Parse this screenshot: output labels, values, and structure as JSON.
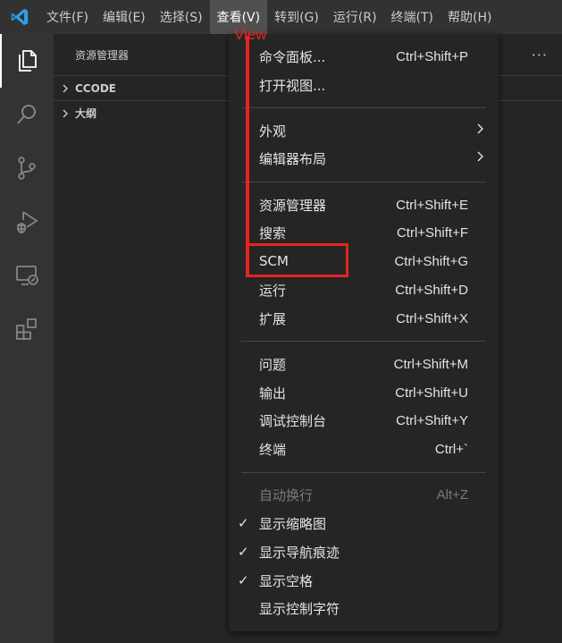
{
  "menubar": {
    "items": [
      "文件(F)",
      "编辑(E)",
      "选择(S)",
      "查看(V)",
      "转到(G)",
      "运行(R)",
      "终端(T)",
      "帮助(H)"
    ],
    "active_index": 3
  },
  "activitybar": {
    "icons": [
      "explorer-icon",
      "search-icon",
      "source-control-icon",
      "run-debug-icon",
      "remote-explorer-icon",
      "extensions-icon"
    ]
  },
  "sidebar": {
    "title": "资源管理器",
    "more": "···",
    "sections": [
      "CCODE",
      "大纲"
    ]
  },
  "annotation": {
    "label": "View",
    "color": "#e52420"
  },
  "dropdown": {
    "groups": [
      [
        {
          "label": "命令面板...",
          "key": "Ctrl+Shift+P"
        },
        {
          "label": "打开视图...",
          "key": ""
        }
      ],
      [
        {
          "label": "外观",
          "key": "",
          "submenu": true
        },
        {
          "label": "编辑器布局",
          "key": "",
          "submenu": true
        }
      ],
      [
        {
          "label": "资源管理器",
          "key": "Ctrl+Shift+E"
        },
        {
          "label": "搜索",
          "key": "Ctrl+Shift+F"
        },
        {
          "label": "SCM",
          "key": "Ctrl+Shift+G"
        },
        {
          "label": "运行",
          "key": "Ctrl+Shift+D"
        },
        {
          "label": "扩展",
          "key": "Ctrl+Shift+X"
        }
      ],
      [
        {
          "label": "问题",
          "key": "Ctrl+Shift+M"
        },
        {
          "label": "输出",
          "key": "Ctrl+Shift+U"
        },
        {
          "label": "调试控制台",
          "key": "Ctrl+Shift+Y"
        },
        {
          "label": "终端",
          "key": "Ctrl+`"
        }
      ],
      [
        {
          "label": "自动换行",
          "key": "Alt+Z",
          "disabled": true
        },
        {
          "label": "显示缩略图",
          "key": "",
          "checked": true
        },
        {
          "label": "显示导航痕迹",
          "key": "",
          "checked": true
        },
        {
          "label": "显示空格",
          "key": "",
          "checked": true
        },
        {
          "label": "显示控制字符",
          "key": ""
        }
      ]
    ]
  }
}
